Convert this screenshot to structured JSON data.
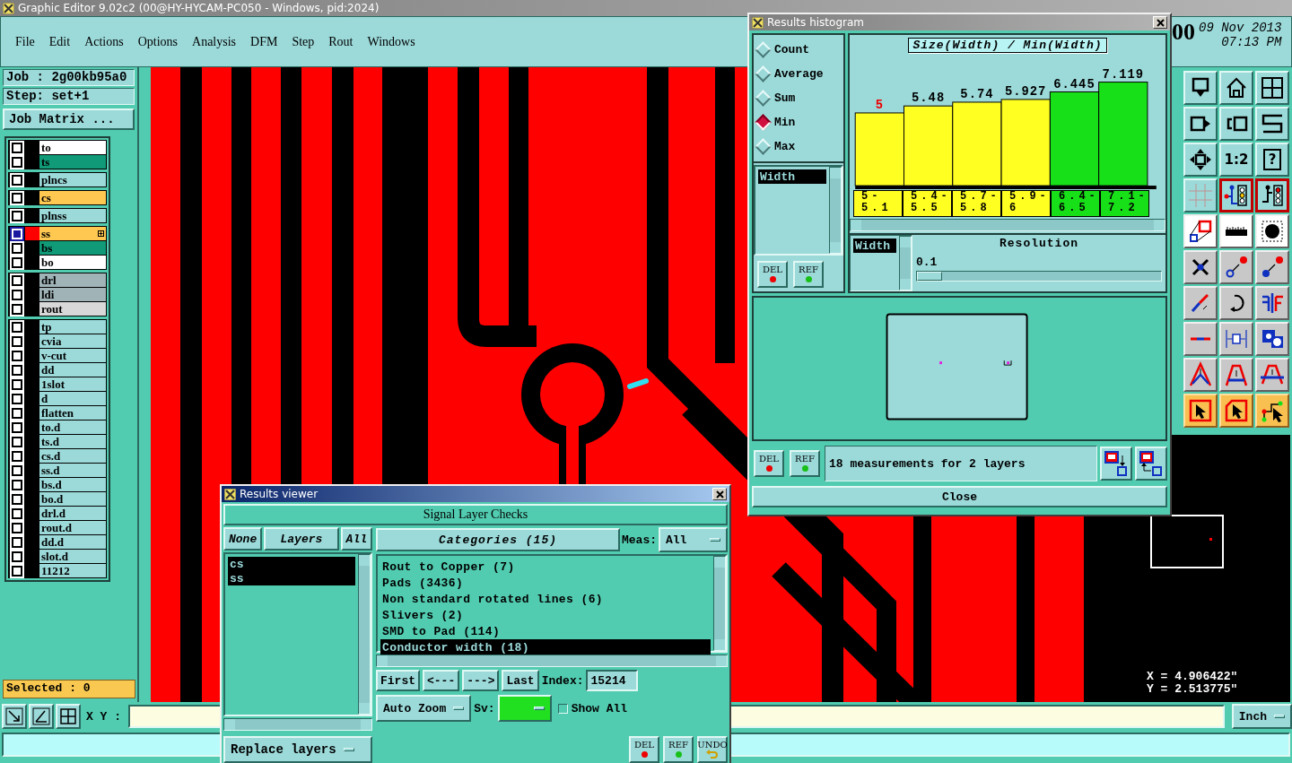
{
  "window": {
    "title": "Graphic Editor 9.02c2 (00@HY-HYCAM-PC050 - Windows, pid:2024)"
  },
  "menu": [
    "File",
    "Edit",
    "Actions",
    "Options",
    "Analysis",
    "DFM",
    "Step",
    "Rout",
    "Windows"
  ],
  "clock": {
    "fragment": "00",
    "date": "09 Nov 2013",
    "time": "07:13 PM"
  },
  "job": {
    "job_label": "Job : 2g00kb95a0",
    "step_label": "Step: set+1",
    "matrix_button": "Job Matrix ..."
  },
  "layer_groups": [
    [
      {
        "name": "to",
        "color": "#ffffff",
        "selected": false
      },
      {
        "name": "ts",
        "color": "#109a78",
        "selected": false
      }
    ],
    [
      {
        "name": "plncs",
        "color": "#9cdada",
        "selected": false
      }
    ],
    [
      {
        "name": "cs",
        "color": "#ffc850",
        "selected": false
      }
    ],
    [
      {
        "name": "plnss",
        "color": "#9cdada",
        "selected": false
      }
    ],
    [
      {
        "name": "ss",
        "color": "#ffc850",
        "selected": true
      },
      {
        "name": "bs",
        "color": "#109a78",
        "selected": false
      },
      {
        "name": "bo",
        "color": "#ffffff",
        "selected": false
      }
    ],
    [
      {
        "name": "drl",
        "color": "#a0b4b8",
        "selected": false
      },
      {
        "name": "ldi",
        "color": "#a0b4b8",
        "selected": false
      },
      {
        "name": "rout",
        "color": "#d8d8d8",
        "selected": false
      }
    ],
    [
      {
        "name": "tp",
        "color": "#9cdada",
        "selected": false
      },
      {
        "name": "cvia",
        "color": "#9cdada",
        "selected": false
      },
      {
        "name": "v-cut",
        "color": "#9cdada",
        "selected": false
      },
      {
        "name": "dd",
        "color": "#9cdada",
        "selected": false
      },
      {
        "name": "1slot",
        "color": "#9cdada",
        "selected": false
      },
      {
        "name": "d",
        "color": "#9cdada",
        "selected": false
      },
      {
        "name": "flatten",
        "color": "#9cdada",
        "selected": false
      },
      {
        "name": "to.d",
        "color": "#9cdada",
        "selected": false
      },
      {
        "name": "ts.d",
        "color": "#9cdada",
        "selected": false
      },
      {
        "name": "cs.d",
        "color": "#9cdada",
        "selected": false
      },
      {
        "name": "ss.d",
        "color": "#9cdada",
        "selected": false
      },
      {
        "name": "bs.d",
        "color": "#9cdada",
        "selected": false
      },
      {
        "name": "bo.d",
        "color": "#9cdada",
        "selected": false
      },
      {
        "name": "drl.d",
        "color": "#9cdada",
        "selected": false
      },
      {
        "name": "rout.d",
        "color": "#9cdada",
        "selected": false
      },
      {
        "name": "dd.d",
        "color": "#9cdada",
        "selected": false
      },
      {
        "name": "slot.d",
        "color": "#9cdada",
        "selected": false
      },
      {
        "name": "11212",
        "color": "#9cdada",
        "selected": false
      }
    ]
  ],
  "selected_count": "Selected : 0",
  "toolbar": {
    "ratio_label": "1:2",
    "help_label": "?"
  },
  "coords": {
    "x": "X = 4.906422\"",
    "y": "Y = 2.513775\""
  },
  "bottom_bar": {
    "xy_label": "X Y :",
    "units": "Inch"
  },
  "histogram_window": {
    "title": "Results histogram",
    "modes": [
      {
        "label": "Count",
        "selected": false
      },
      {
        "label": "Average",
        "selected": false
      },
      {
        "label": "Sum",
        "selected": false
      },
      {
        "label": "Min",
        "selected": true
      },
      {
        "label": "Max",
        "selected": false
      }
    ],
    "attributes": [
      {
        "label": "Width",
        "selected": true
      }
    ],
    "top_buttons": [
      "DEL",
      "REF"
    ],
    "chart_data": {
      "type": "bar",
      "title": "Size(Width) / Min(Width)",
      "categories": [
        "5-5.1",
        "5.4-5.5",
        "5.7-5.8",
        "5.9-6",
        "6.4-6.5",
        "7.1-7.2"
      ],
      "series": [
        {
          "color": "#ffff22",
          "values": [
            5,
            5.48,
            5.74,
            5.927,
            null,
            null
          ]
        },
        {
          "color": "#18e018",
          "values": [
            null,
            null,
            null,
            null,
            6.445,
            7.119
          ]
        }
      ],
      "stacked": true,
      "data_labels": true
    },
    "resolution_attributes": [
      {
        "label": "Width",
        "selected": true
      }
    ],
    "resolution_label": "Resolution",
    "resolution_value": "0.1",
    "resolution_slider": {
      "level": 0
    },
    "bottom_buttons": [
      "DEL",
      "REF"
    ],
    "message": "18 measurements for 2 layers",
    "close": "Close"
  },
  "results_viewer": {
    "title": "Results viewer",
    "header": "Signal Layer Checks",
    "layer_buttons": [
      "None",
      "Layers",
      "All"
    ],
    "layers": [
      {
        "name": "cs",
        "selected": true
      },
      {
        "name": "ss",
        "selected": true
      }
    ],
    "categories_header": "Categories (15)",
    "meas_label": "Meas:",
    "meas_value": "All",
    "categories": [
      {
        "label": "Rout to Copper (7)",
        "selected": false
      },
      {
        "label": "Pads (3436)",
        "selected": false
      },
      {
        "label": "Non standard rotated lines (6)",
        "selected": false
      },
      {
        "label": "Slivers (2)",
        "selected": false
      },
      {
        "label": "SMD to Pad (114)",
        "selected": false
      },
      {
        "label": "Conductor width (18)",
        "selected": true
      }
    ],
    "nav": [
      "First",
      "<---",
      "--->",
      "Last"
    ],
    "index_label": "Index:",
    "index_value": "15214",
    "zoom_mode": "Auto Zoom",
    "sv_label": "Sv:",
    "show_all": {
      "label": "Show All",
      "checked": false
    },
    "replace_mode": "Replace layers",
    "buttons": [
      "DEL",
      "REF",
      "UNDO"
    ]
  }
}
